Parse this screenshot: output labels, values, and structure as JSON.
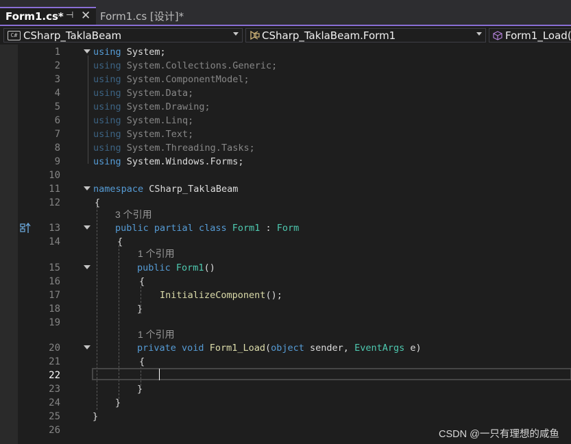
{
  "tabs": [
    {
      "label": "Form1.cs*",
      "active": true
    },
    {
      "label": "Form1.cs [设计]*",
      "active": false
    }
  ],
  "tab_icons": {
    "pin": "pin-icon",
    "close": "close-icon"
  },
  "nav": {
    "project": "CSharp_TaklaBeam",
    "class": "CSharp_TaklaBeam.Form1",
    "member": "Form1_Load(",
    "cs_badge": "C#"
  },
  "colors": {
    "keyword": "#569cd6",
    "type": "#4ec9b0",
    "method": "#dcdcaa",
    "text": "#dcdcdc",
    "line_number": "#858585",
    "accent": "#8a6fd6",
    "background": "#1e1e1e"
  },
  "codelens": {
    "cl1": "3 个引用",
    "cl2": "1 个引用",
    "cl3": "1 个引用"
  },
  "current_line": "22",
  "watermark": "CSDN @一只有理想的咸鱼",
  "lines": [
    {
      "n": "1",
      "segs": [
        {
          "t": "using",
          "c": "kw"
        },
        {
          "t": " System;",
          "c": ""
        }
      ]
    },
    {
      "n": "2",
      "segs": [
        {
          "t": "using",
          "c": "kw"
        },
        {
          "t": " System.Collections.Generic;",
          "c": ""
        }
      ]
    },
    {
      "n": "3",
      "segs": [
        {
          "t": "using",
          "c": "kw"
        },
        {
          "t": " System.ComponentModel;",
          "c": ""
        }
      ]
    },
    {
      "n": "4",
      "segs": [
        {
          "t": "using",
          "c": "kw"
        },
        {
          "t": " System.Data;",
          "c": ""
        }
      ]
    },
    {
      "n": "5",
      "segs": [
        {
          "t": "using",
          "c": "kw"
        },
        {
          "t": " System.Drawing;",
          "c": ""
        }
      ]
    },
    {
      "n": "6",
      "segs": [
        {
          "t": "using",
          "c": "kw"
        },
        {
          "t": " System.Linq;",
          "c": ""
        }
      ]
    },
    {
      "n": "7",
      "segs": [
        {
          "t": "using",
          "c": "kw"
        },
        {
          "t": " System.Text;",
          "c": ""
        }
      ]
    },
    {
      "n": "8",
      "segs": [
        {
          "t": "using",
          "c": "kw"
        },
        {
          "t": " System.Threading.Tasks;",
          "c": ""
        }
      ]
    },
    {
      "n": "9",
      "segs": [
        {
          "t": "using",
          "c": "kw"
        },
        {
          "t": " System.Windows.Forms;",
          "c": ""
        }
      ]
    },
    {
      "n": "10",
      "segs": []
    },
    {
      "n": "11",
      "segs": [
        {
          "t": "namespace",
          "c": "kw"
        },
        {
          "t": " CSharp_TaklaBeam",
          "c": ""
        }
      ]
    },
    {
      "n": "12",
      "segs": [
        {
          "t": "{",
          "c": ""
        }
      ]
    },
    {
      "n": "13",
      "segs": [
        {
          "t": "public",
          "c": "kw"
        },
        {
          "t": " ",
          "c": ""
        },
        {
          "t": "partial",
          "c": "kw"
        },
        {
          "t": " ",
          "c": ""
        },
        {
          "t": "class",
          "c": "kw"
        },
        {
          "t": " ",
          "c": ""
        },
        {
          "t": "Form1",
          "c": "ty"
        },
        {
          "t": " : ",
          "c": ""
        },
        {
          "t": "Form",
          "c": "ty"
        }
      ]
    },
    {
      "n": "14",
      "segs": [
        {
          "t": "{",
          "c": ""
        }
      ]
    },
    {
      "n": "15",
      "segs": [
        {
          "t": "public",
          "c": "kw"
        },
        {
          "t": " ",
          "c": ""
        },
        {
          "t": "Form1",
          "c": "ty"
        },
        {
          "t": "()",
          "c": ""
        }
      ]
    },
    {
      "n": "16",
      "segs": [
        {
          "t": "{",
          "c": ""
        }
      ]
    },
    {
      "n": "17",
      "segs": [
        {
          "t": "InitializeComponent",
          "c": "fn"
        },
        {
          "t": "();",
          "c": ""
        }
      ]
    },
    {
      "n": "18",
      "segs": [
        {
          "t": "}",
          "c": ""
        }
      ]
    },
    {
      "n": "19",
      "segs": []
    },
    {
      "n": "20",
      "segs": [
        {
          "t": "private",
          "c": "kw"
        },
        {
          "t": " ",
          "c": ""
        },
        {
          "t": "void",
          "c": "kw"
        },
        {
          "t": " ",
          "c": ""
        },
        {
          "t": "Form1_Load",
          "c": "fn"
        },
        {
          "t": "(",
          "c": ""
        },
        {
          "t": "object",
          "c": "kw"
        },
        {
          "t": " sender, ",
          "c": ""
        },
        {
          "t": "EventArgs",
          "c": "ty"
        },
        {
          "t": " e)",
          "c": ""
        }
      ]
    },
    {
      "n": "21",
      "segs": [
        {
          "t": "{",
          "c": ""
        }
      ]
    },
    {
      "n": "22",
      "segs": []
    },
    {
      "n": "23",
      "segs": [
        {
          "t": "}",
          "c": ""
        }
      ]
    },
    {
      "n": "24",
      "segs": [
        {
          "t": "}",
          "c": ""
        }
      ]
    },
    {
      "n": "25",
      "segs": [
        {
          "t": "}",
          "c": ""
        }
      ]
    },
    {
      "n": "26",
      "segs": []
    }
  ]
}
